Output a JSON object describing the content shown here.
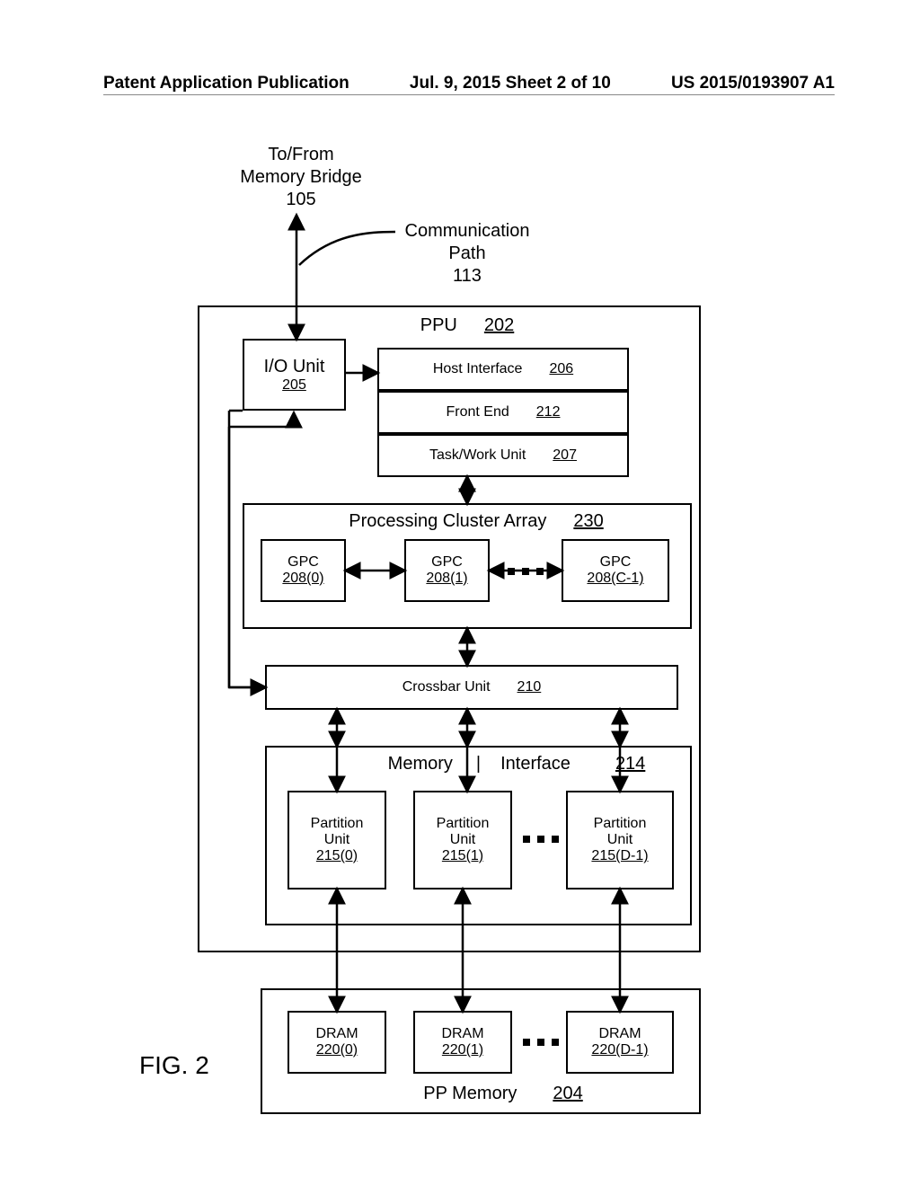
{
  "header": {
    "left": "Patent Application Publication",
    "center": "Jul. 9, 2015  Sheet 2 of 10",
    "right": "US 2015/0193907 A1"
  },
  "figure_label": "FIG. 2",
  "top_labels": {
    "bridge_line1": "To/From",
    "bridge_line2": "Memory Bridge",
    "bridge_ref": "105",
    "comm_line1": "Communication",
    "comm_line2": "Path",
    "comm_ref": "113"
  },
  "ppu": {
    "title": "PPU",
    "ref": "202"
  },
  "io_unit": {
    "title": "I/O Unit",
    "ref": "205"
  },
  "host_if": {
    "title": "Host Interface",
    "ref": "206"
  },
  "front_end": {
    "title": "Front End",
    "ref": "212"
  },
  "task_unit": {
    "title": "Task/Work Unit",
    "ref": "207"
  },
  "cluster_array": {
    "title": "Processing Cluster Array",
    "ref": "230"
  },
  "gpc": {
    "title": "GPC",
    "refs": [
      "208(0)",
      "208(1)",
      "208(C-1)"
    ]
  },
  "crossbar": {
    "title": "Crossbar Unit",
    "ref": "210"
  },
  "mem_if": {
    "title": "Memory Interface",
    "ref": "214"
  },
  "partition": {
    "title": "Partition Unit",
    "refs": [
      "215(0)",
      "215(1)",
      "215(D-1)"
    ]
  },
  "pp_memory": {
    "title": "PP Memory",
    "ref": "204"
  },
  "dram": {
    "title": "DRAM",
    "refs": [
      "220(0)",
      "220(1)",
      "220(D-1)"
    ]
  }
}
